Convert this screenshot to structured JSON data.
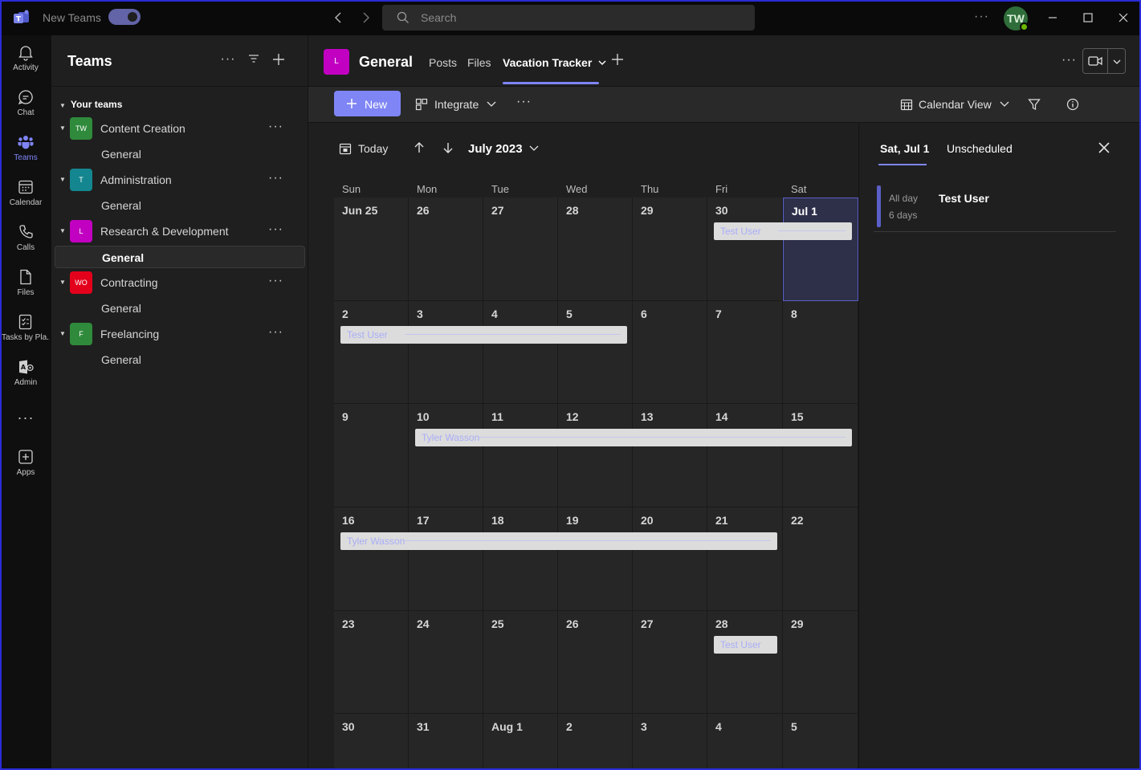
{
  "titlebar": {
    "app_name": "New Teams",
    "search_placeholder": "Search",
    "avatar_initials": "TW"
  },
  "rail": [
    {
      "name": "activity",
      "label": "Activity"
    },
    {
      "name": "chat",
      "label": "Chat"
    },
    {
      "name": "teams",
      "label": "Teams"
    },
    {
      "name": "calendar",
      "label": "Calendar"
    },
    {
      "name": "calls",
      "label": "Calls"
    },
    {
      "name": "files",
      "label": "Files"
    },
    {
      "name": "tasks",
      "label": "Tasks by Pla..."
    },
    {
      "name": "admin",
      "label": "Admin"
    },
    {
      "name": "apps",
      "label": "Apps"
    }
  ],
  "teams_panel": {
    "title": "Teams",
    "section": "Your teams",
    "teams": [
      {
        "initials": "TW",
        "name": "Content Creation",
        "color": "#2f8a3b",
        "channel": "General"
      },
      {
        "initials": "T",
        "name": "Administration",
        "color": "#13868f",
        "channel": "General"
      },
      {
        "initials": "L",
        "name": "Research & Development",
        "color": "#c100c1",
        "channel": "General"
      },
      {
        "initials": "WO",
        "name": "Contracting",
        "color": "#e3001b",
        "channel": "General"
      },
      {
        "initials": "F",
        "name": "Freelancing",
        "color": "#2f8a3b",
        "channel": "General"
      }
    ]
  },
  "channel": {
    "tile_initial": "L",
    "name": "General",
    "tabs": {
      "posts": "Posts",
      "files": "Files",
      "vacation": "Vacation Tracker"
    }
  },
  "toolbar": {
    "new_label": "New",
    "integrate_label": "Integrate",
    "calendar_view_label": "Calendar View"
  },
  "calendar": {
    "today_label": "Today",
    "month_label": "July 2023",
    "weekdays": [
      "Sun",
      "Mon",
      "Tue",
      "Wed",
      "Thu",
      "Fri",
      "Sat"
    ],
    "weeks": [
      [
        "Jun 25",
        "26",
        "27",
        "28",
        "29",
        "30",
        "Jul 1"
      ],
      [
        "2",
        "3",
        "4",
        "5",
        "6",
        "7",
        "8"
      ],
      [
        "9",
        "10",
        "11",
        "12",
        "13",
        "14",
        "15"
      ],
      [
        "16",
        "17",
        "18",
        "19",
        "20",
        "21",
        "22"
      ],
      [
        "23",
        "24",
        "25",
        "26",
        "27",
        "28",
        "29"
      ],
      [
        "30",
        "31",
        "Aug 1",
        "2",
        "3",
        "4",
        "5"
      ]
    ],
    "selected_day": "Jul 1",
    "events": [
      {
        "title": "Test User"
      },
      {
        "title": "Test User"
      },
      {
        "title": "Tyler Wasson"
      },
      {
        "title": "Tyler Wasson"
      },
      {
        "title": "Test User"
      }
    ]
  },
  "right_panel": {
    "tab_selected": "Sat, Jul 1",
    "tab_other": "Unscheduled",
    "event": {
      "allday": "All day",
      "duration": "6 days",
      "who": "Test User"
    }
  },
  "colors": {
    "accent": "#7f85f5",
    "selection_border": "#5b5fc7"
  }
}
